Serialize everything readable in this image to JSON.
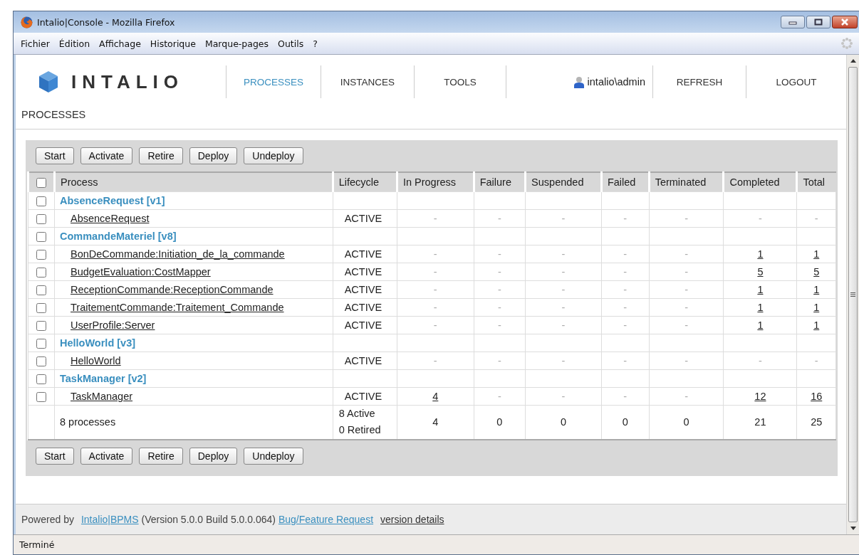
{
  "window": {
    "title": "Intalio|Console - Mozilla Firefox"
  },
  "menu": [
    "Fichier",
    "Édition",
    "Affichage",
    "Historique",
    "Marque-pages",
    "Outils",
    "?"
  ],
  "header": {
    "logo": "INTALIO",
    "nav": [
      {
        "label": "PROCESSES",
        "selected": true
      },
      {
        "label": "INSTANCES",
        "selected": false
      },
      {
        "label": "TOOLS",
        "selected": false
      }
    ],
    "user": "intalio\\admin",
    "actions": [
      "REFRESH",
      "LOGOUT"
    ],
    "breadcrumb": "PROCESSES"
  },
  "toolbar_top": [
    "Start",
    "Activate",
    "Retire",
    "Deploy",
    "Undeploy"
  ],
  "table": {
    "select_all": {
      "checked": false
    },
    "columns": [
      "Process",
      "Lifecycle",
      "In Progress",
      "Failure",
      "Suspended",
      "Failed",
      "Terminated",
      "Completed",
      "Total"
    ],
    "rows": [
      {
        "kind": "group",
        "checked": false,
        "name": "AbsenceRequest [v1]"
      },
      {
        "kind": "process",
        "checked": false,
        "name": "AbsenceRequest",
        "lifecycle": "ACTIVE",
        "values": [
          {
            "text": "-",
            "link": false
          },
          {
            "text": "-",
            "link": false
          },
          {
            "text": "-",
            "link": false
          },
          {
            "text": "-",
            "link": false
          },
          {
            "text": "-",
            "link": false
          },
          {
            "text": "-",
            "link": false
          },
          {
            "text": "-",
            "link": false
          }
        ]
      },
      {
        "kind": "group",
        "checked": false,
        "name": "CommandeMateriel [v8]"
      },
      {
        "kind": "process",
        "checked": false,
        "name": "BonDeCommande:Initiation_de_la_commande",
        "lifecycle": "ACTIVE",
        "values": [
          {
            "text": "-",
            "link": false
          },
          {
            "text": "-",
            "link": false
          },
          {
            "text": "-",
            "link": false
          },
          {
            "text": "-",
            "link": false
          },
          {
            "text": "-",
            "link": false
          },
          {
            "text": "1",
            "link": true
          },
          {
            "text": "1",
            "link": true
          }
        ]
      },
      {
        "kind": "process",
        "checked": false,
        "name": "BudgetEvaluation:CostMapper",
        "lifecycle": "ACTIVE",
        "values": [
          {
            "text": "-",
            "link": false
          },
          {
            "text": "-",
            "link": false
          },
          {
            "text": "-",
            "link": false
          },
          {
            "text": "-",
            "link": false
          },
          {
            "text": "-",
            "link": false
          },
          {
            "text": "5",
            "link": true
          },
          {
            "text": "5",
            "link": true
          }
        ]
      },
      {
        "kind": "process",
        "checked": false,
        "name": "ReceptionCommande:ReceptionCommande",
        "lifecycle": "ACTIVE",
        "values": [
          {
            "text": "-",
            "link": false
          },
          {
            "text": "-",
            "link": false
          },
          {
            "text": "-",
            "link": false
          },
          {
            "text": "-",
            "link": false
          },
          {
            "text": "-",
            "link": false
          },
          {
            "text": "1",
            "link": true
          },
          {
            "text": "1",
            "link": true
          }
        ]
      },
      {
        "kind": "process",
        "checked": false,
        "name": "TraitementCommande:Traitement_Commande",
        "lifecycle": "ACTIVE",
        "values": [
          {
            "text": "-",
            "link": false
          },
          {
            "text": "-",
            "link": false
          },
          {
            "text": "-",
            "link": false
          },
          {
            "text": "-",
            "link": false
          },
          {
            "text": "-",
            "link": false
          },
          {
            "text": "1",
            "link": true
          },
          {
            "text": "1",
            "link": true
          }
        ]
      },
      {
        "kind": "process",
        "checked": false,
        "name": "UserProfile:Server",
        "lifecycle": "ACTIVE",
        "values": [
          {
            "text": "-",
            "link": false
          },
          {
            "text": "-",
            "link": false
          },
          {
            "text": "-",
            "link": false
          },
          {
            "text": "-",
            "link": false
          },
          {
            "text": "-",
            "link": false
          },
          {
            "text": "1",
            "link": true
          },
          {
            "text": "1",
            "link": true
          }
        ]
      },
      {
        "kind": "group",
        "checked": false,
        "name": "HelloWorld [v3]"
      },
      {
        "kind": "process",
        "checked": false,
        "name": "HelloWorld",
        "lifecycle": "ACTIVE",
        "values": [
          {
            "text": "-",
            "link": false
          },
          {
            "text": "-",
            "link": false
          },
          {
            "text": "-",
            "link": false
          },
          {
            "text": "-",
            "link": false
          },
          {
            "text": "-",
            "link": false
          },
          {
            "text": "-",
            "link": false
          },
          {
            "text": "-",
            "link": false
          }
        ]
      },
      {
        "kind": "group",
        "checked": false,
        "name": "TaskManager [v2]"
      },
      {
        "kind": "process",
        "checked": false,
        "name": "TaskManager",
        "lifecycle": "ACTIVE",
        "values": [
          {
            "text": "4",
            "link": true
          },
          {
            "text": "-",
            "link": false
          },
          {
            "text": "-",
            "link": false
          },
          {
            "text": "-",
            "link": false
          },
          {
            "text": "-",
            "link": false
          },
          {
            "text": "12",
            "link": true
          },
          {
            "text": "16",
            "link": true
          }
        ]
      }
    ],
    "summary": {
      "label": "8 processes",
      "lifecycle": [
        "8 Active",
        "0 Retired"
      ],
      "values": [
        "4",
        "0",
        "0",
        "0",
        "0",
        "21",
        "25"
      ]
    }
  },
  "toolbar_bottom": [
    "Start",
    "Activate",
    "Retire",
    "Deploy",
    "Undeploy"
  ],
  "footer": {
    "prefix": "Powered by",
    "product_link": "Intalio|BPMS",
    "version": "(Version 5.0.0 Build 5.0.0.064)",
    "bug_link": "Bug/Feature Request",
    "details_link": "version details"
  },
  "status_bar": "Terminé"
}
